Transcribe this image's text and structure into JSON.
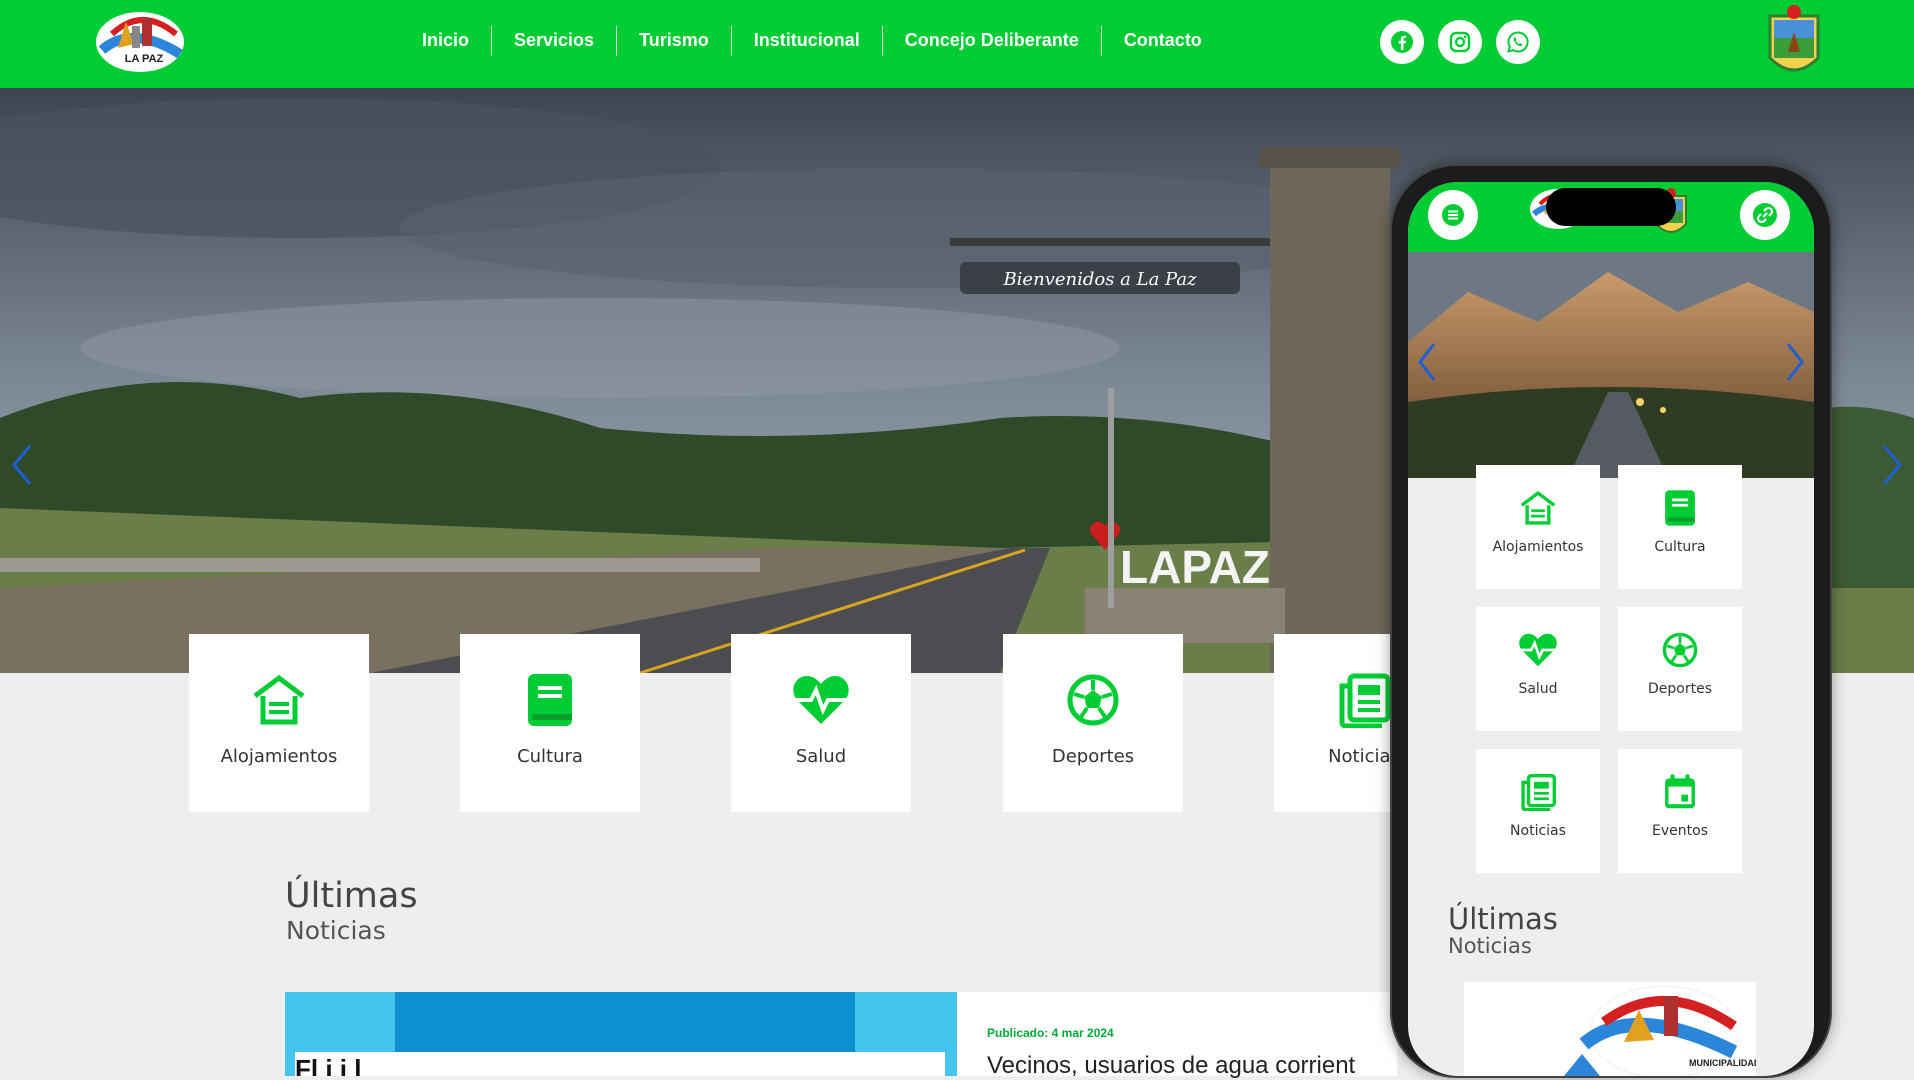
{
  "header": {
    "nav": [
      "Inicio",
      "Servicios",
      "Turismo",
      "Institucional",
      "Concejo Deliberante",
      "Contacto"
    ],
    "logo_text": "LA PAZ",
    "social": [
      "facebook-icon",
      "instagram-icon",
      "whatsapp-icon"
    ]
  },
  "hero": {
    "sign_text": "Bienvenidos a La Paz",
    "letters_text": "LAPAZ"
  },
  "categories": [
    {
      "label": "Alojamientos",
      "icon": "house-icon"
    },
    {
      "label": "Cultura",
      "icon": "book-icon"
    },
    {
      "label": "Salud",
      "icon": "heartbeat-icon"
    },
    {
      "label": "Deportes",
      "icon": "soccer-ball-icon"
    },
    {
      "label": "Noticias",
      "icon": "newspaper-icon"
    }
  ],
  "latest": {
    "title": "Últimas",
    "subtitle": "Noticias",
    "news": {
      "image_text": "Fl   i i l",
      "date": "Publicado: 4 mar 2024",
      "title": "Vecinos, usuarios de agua corrient"
    }
  },
  "phone": {
    "categories": [
      {
        "label": "Alojamientos",
        "icon": "house-icon"
      },
      {
        "label": "Cultura",
        "icon": "book-icon"
      },
      {
        "label": "Salud",
        "icon": "heartbeat-icon"
      },
      {
        "label": "Deportes",
        "icon": "soccer-ball-icon"
      },
      {
        "label": "Noticias",
        "icon": "newspaper-icon"
      },
      {
        "label": "Eventos",
        "icon": "calendar-icon"
      }
    ],
    "title": "Últimas",
    "subtitle": "Noticias",
    "news_logo_text": "MUNICIPALIDAD DE"
  },
  "colors": {
    "brand_green": "#00cc33",
    "accent_blue": "#1e5fd6"
  }
}
